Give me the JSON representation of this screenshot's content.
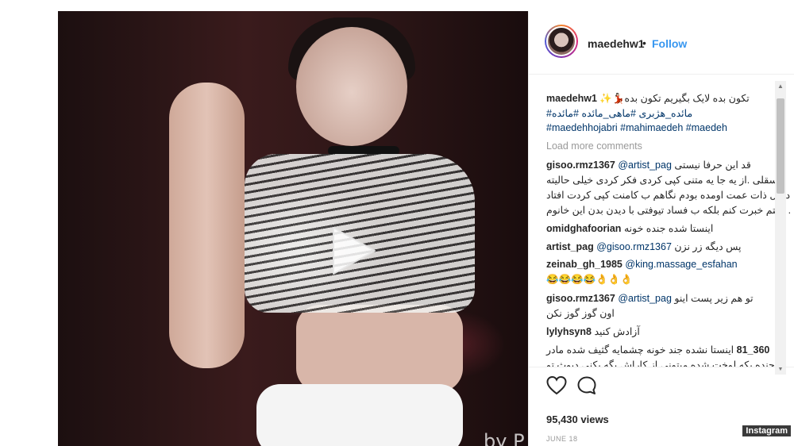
{
  "post": {
    "username": "maedehw1",
    "separator": "•",
    "follow_label": "Follow"
  },
  "video": {
    "watermark": "by P",
    "play_icon": "play-icon"
  },
  "caption": {
    "username": "maedehw1",
    "text": "تکون بده لایک بگیریم تکون بده💃🏻✨",
    "line2": "مائده_هژبری #ماهی_مائده #مائده#",
    "tags_line3": "#maedehhojabri #mahimaedeh #maedeh"
  },
  "load_more_label": "Load more comments",
  "comments": [
    {
      "username": "gisoo.rmz1367",
      "mention": "@artist_pag",
      "lines": [
        "قد این حرفا نیستی",
        "فسقلی .از یه جا یه متنی کپی کردی فکر کردی خیلی حالیته",
        "دنبال ذات عمت اومده بودم نگاهم ب کامنت کپی کردت افتاد",
        ". گفتم خبرت کنم بلکه ب فساد تیوفتی با دیدن بدن این خانوم"
      ]
    },
    {
      "username": "omidghafoorian",
      "text": "اینستا شده جنده خونه"
    },
    {
      "username": "artist_pag",
      "mention": "@gisoo.rmz1367",
      "text": "پس دیگه زر نزن"
    },
    {
      "username": "zeinab_gh_1985",
      "mention": "@king.massage_esfahan",
      "line2": "😂😂😂😂👌👌👌"
    },
    {
      "username": "gisoo.rmz1367",
      "mention": "@artist_pag",
      "text": "تو هم زیر پست اینو",
      "line2": "اون گوز گوز نکن"
    },
    {
      "username": "lylyhsyn8",
      "text": "آزادش کنید"
    },
    {
      "username": "81_360",
      "text": "اینستا نشده جند خونه چشمایه گثیف شده مادر",
      "line2": "جنده بکه لوخت شده میتونی از کاراش پگه بکنی دیوث تو"
    }
  ],
  "scrollbar": {
    "up": "▲",
    "down": "▼"
  },
  "actions": {
    "like_icon": "heart-icon",
    "comment_icon": "comment-icon",
    "views": "95,430 views",
    "date": "JUNE 18"
  },
  "credit": "Instagram"
}
